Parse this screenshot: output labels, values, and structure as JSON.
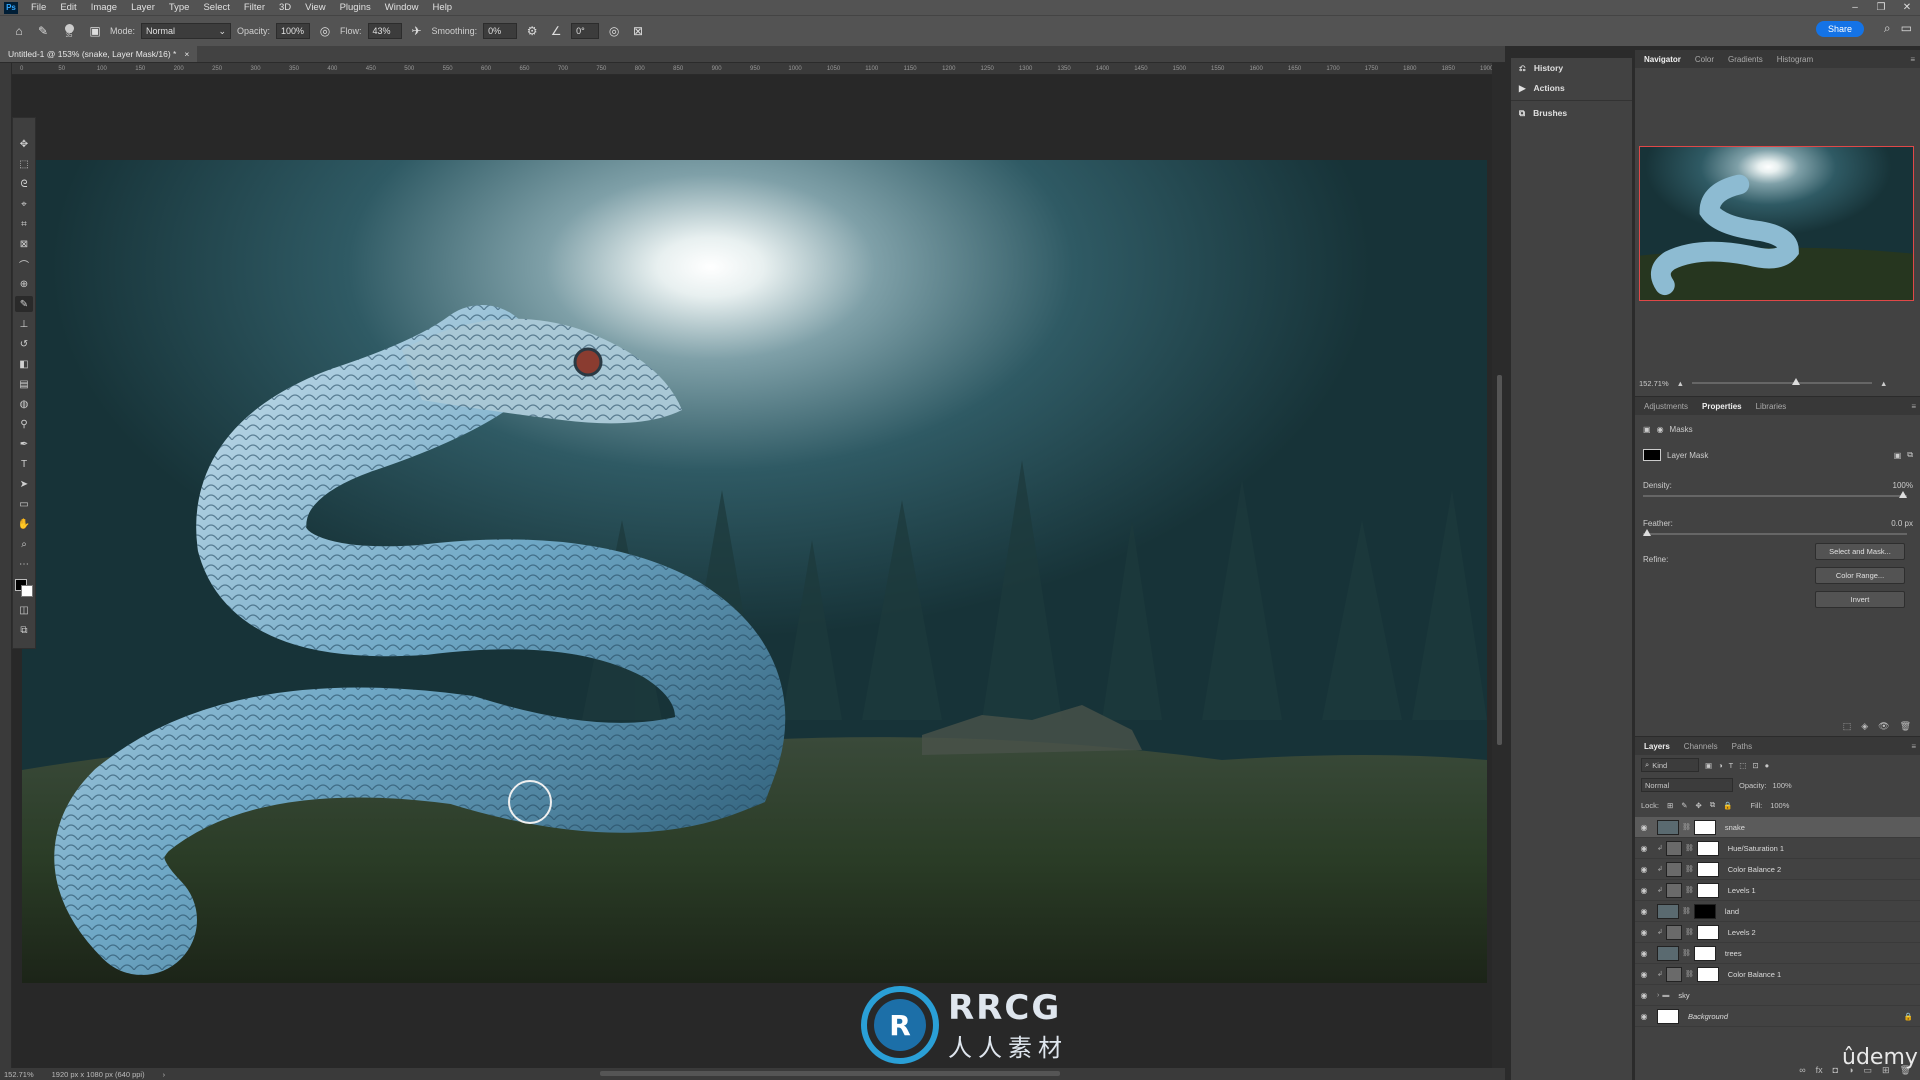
{
  "menubar": {
    "logo": "Ps",
    "items": [
      "File",
      "Edit",
      "Image",
      "Layer",
      "Type",
      "Select",
      "Filter",
      "3D",
      "View",
      "Plugins",
      "Window",
      "Help"
    ]
  },
  "options": {
    "brush_size": "35",
    "mode_label": "Mode:",
    "mode_value": "Normal",
    "opacity_label": "Opacity:",
    "opacity_value": "100%",
    "flow_label": "Flow:",
    "flow_value": "43%",
    "smoothing_label": "Smoothing:",
    "smoothing_value": "0%",
    "angle_value": "0°",
    "share_label": "Share"
  },
  "document": {
    "tab_title": "Untitled-1 @ 153% (snake, Layer Mask/16) *",
    "ruler_ticks": [
      "0",
      "50",
      "100",
      "150",
      "200",
      "250",
      "300",
      "350",
      "400",
      "450",
      "500",
      "550",
      "600",
      "650",
      "700",
      "750",
      "800",
      "850",
      "900",
      "950",
      "1000",
      "1050",
      "1100",
      "1150",
      "1200",
      "1250",
      "1300",
      "1350",
      "1400",
      "1450",
      "1500",
      "1550",
      "1600",
      "1650",
      "1700",
      "1750",
      "1800",
      "1850",
      "1900"
    ]
  },
  "status": {
    "zoom": "152.71%",
    "doc_info": "1920 px x 1080 px (640 ppi)"
  },
  "mid_panel": {
    "items": [
      {
        "icon": "history-icon",
        "label": "History"
      },
      {
        "icon": "actions-icon",
        "label": "Actions"
      },
      {
        "icon": "brushes-icon",
        "label": "Brushes"
      }
    ]
  },
  "navigator": {
    "tabs": [
      "Navigator",
      "Color",
      "Gradients",
      "Histogram"
    ],
    "zoom": "152.71%"
  },
  "properties": {
    "tabs": [
      "Adjustments",
      "Properties",
      "Libraries"
    ],
    "masks_label": "Masks",
    "layer_mask_label": "Layer Mask",
    "density_label": "Density:",
    "density_value": "100%",
    "density_level": 1.0,
    "feather_label": "Feather:",
    "feather_value": "0.0 px",
    "feather_level": 0.0,
    "refine_label": "Refine:",
    "buttons": [
      "Select and Mask...",
      "Color Range...",
      "Invert"
    ]
  },
  "layers": {
    "tabs": [
      "Layers",
      "Channels",
      "Paths"
    ],
    "kind_label": "Kind",
    "blend_mode": "Normal",
    "opacity_label": "Opacity:",
    "opacity_value": "100%",
    "lock_label": "Lock:",
    "fill_label": "Fill:",
    "fill_value": "100%",
    "items": [
      {
        "name": "snake",
        "selected": true,
        "type": "image-mask"
      },
      {
        "name": "Hue/Saturation 1",
        "selected": false,
        "type": "adjustment"
      },
      {
        "name": "Color Balance 2",
        "selected": false,
        "type": "adjustment"
      },
      {
        "name": "Levels 1",
        "selected": false,
        "type": "adjustment"
      },
      {
        "name": "land",
        "selected": false,
        "type": "image-mask-dark"
      },
      {
        "name": "Levels 2",
        "selected": false,
        "type": "adjustment"
      },
      {
        "name": "trees",
        "selected": false,
        "type": "image-mask"
      },
      {
        "name": "Color Balance 1",
        "selected": false,
        "type": "adjustment"
      },
      {
        "name": "sky",
        "selected": false,
        "type": "group"
      },
      {
        "name": "Background",
        "selected": false,
        "type": "background"
      }
    ]
  },
  "watermark": {
    "brand": "RRCG",
    "subtitle": "人人素材"
  },
  "udemy_logo": "ûdemy"
}
